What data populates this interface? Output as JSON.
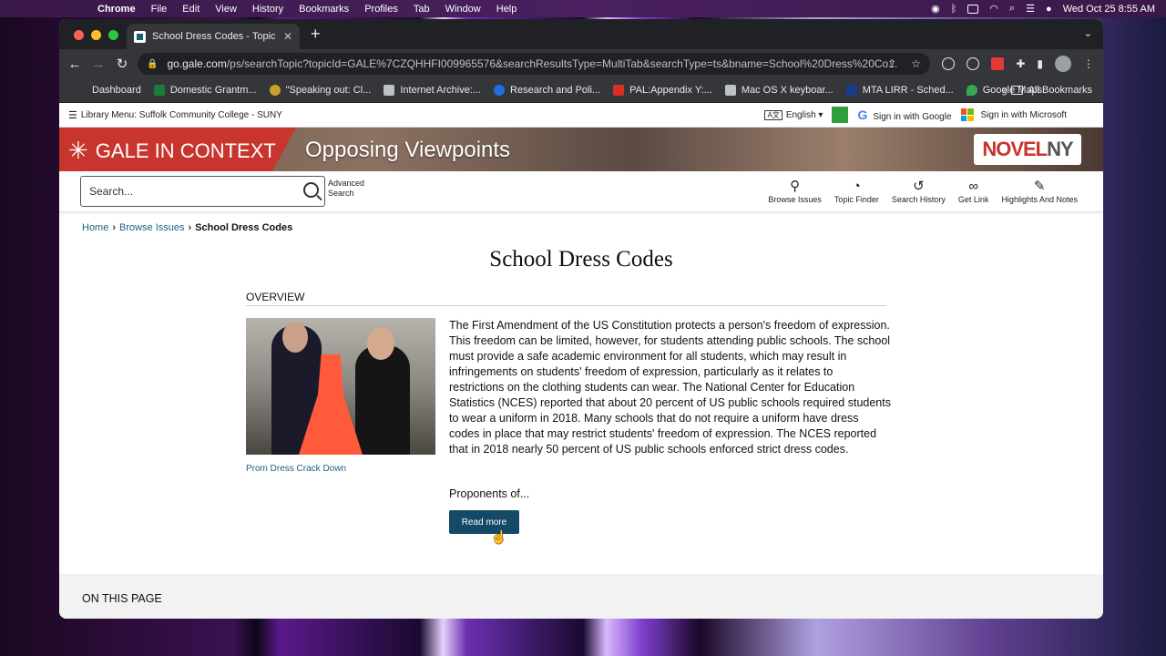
{
  "menubar": {
    "app": "Chrome",
    "items": [
      "File",
      "Edit",
      "View",
      "History",
      "Bookmarks",
      "Profiles",
      "Tab",
      "Window",
      "Help"
    ],
    "datetime": "Wed Oct 25  8:55 AM"
  },
  "browser": {
    "tab_title": "School Dress Codes - Topic -",
    "url_host": "go.gale.com",
    "url_path": "/ps/searchTopic?topicId=GALE%7CZQHHFI009965576&searchResultsType=MultiTab&searchType=ts&bname=School%20Dress%20Co...",
    "bookmarks": [
      {
        "label": "Dashboard",
        "color": "#35363a"
      },
      {
        "label": "Domestic Grantm...",
        "color": "#1b7a3e"
      },
      {
        "label": "\"Speaking out: Cl...",
        "color": "#c9a227"
      },
      {
        "label": "Internet Archive:...",
        "color": "#bdc1c6"
      },
      {
        "label": "Research and Poli...",
        "color": "#1e6ee0"
      },
      {
        "label": "PAL:Appendix Y:...",
        "color": "#d93025"
      },
      {
        "label": "Mac OS X keyboar...",
        "color": "#bdc1c6"
      },
      {
        "label": "MTA LIRR - Sched...",
        "color": "#1a3a8a"
      },
      {
        "label": "Google Maps",
        "color": "#34a853"
      }
    ],
    "bookmarks_more": "»",
    "all_bookmarks": "All Bookmarks"
  },
  "libbar": {
    "menu_label": "Library Menu: Suffolk Community College - SUNY",
    "language": "English",
    "google_signin": "Sign in with Google",
    "microsoft_signin": "Sign in with Microsoft"
  },
  "hero": {
    "brand": "GALE IN CONTEXT",
    "product": "Opposing Viewpoints",
    "partner_a": "NOVEL",
    "partner_b": "NY"
  },
  "search": {
    "placeholder": "Search...",
    "advanced_line1": "Advanced",
    "advanced_line2": "Search"
  },
  "tools": [
    {
      "icon": "lightbulb-icon",
      "glyph": "💡",
      "label": "Browse Issues"
    },
    {
      "icon": "pie-chart-icon",
      "glyph": "◔",
      "label": "Topic Finder"
    },
    {
      "icon": "history-icon",
      "glyph": "↺",
      "label": "Search History"
    },
    {
      "icon": "link-icon",
      "glyph": "🔗",
      "label": "Get Link"
    },
    {
      "icon": "highlighter-icon",
      "glyph": "✎",
      "label": "Highlights And Notes"
    }
  ],
  "breadcrumb": {
    "home": "Home",
    "browse": "Browse Issues",
    "current": "School Dress Codes"
  },
  "page": {
    "title": "School Dress Codes",
    "overview_heading": "OVERVIEW",
    "image_caption": "Prom Dress Crack Down",
    "body": "The First Amendment of the US Constitution protects a person's freedom of expression. This freedom can be limited, however, for students attending public schools. The school must provide a safe academic environment for all students, which may result in infringements on students' freedom of expression, particularly as it relates to restrictions on the clothing students can wear. The National Center for Education Statistics (NCES) reported that about 20 percent of US public schools required students to wear a uniform in 2018. Many schools that do not require a uniform have dress codes in place that may restrict students' freedom of expression. The NCES reported that in 2018 nearly 50 percent of US public schools enforced strict dress codes.",
    "proponents": "Proponents of...",
    "read_more": "Read more",
    "on_this_page": "ON THIS PAGE"
  }
}
